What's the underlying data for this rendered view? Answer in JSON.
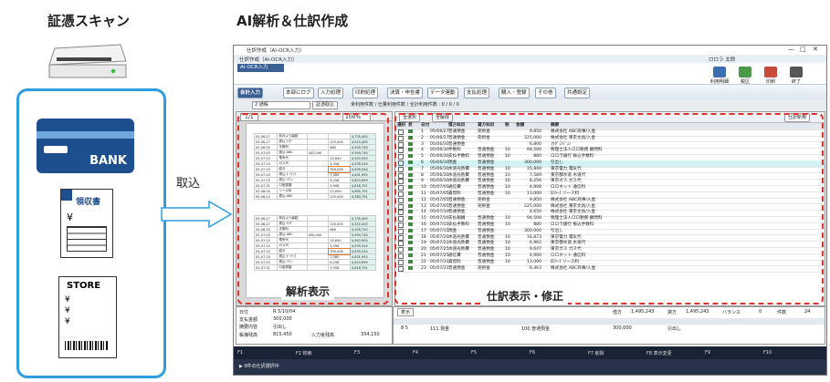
{
  "left_heading": "証憑スキャン",
  "right_heading": "AI解析＆仕訳作成",
  "arrow_label": "取込",
  "card_label": "BANK",
  "receipt_title": "領収書",
  "receipt_yen": "¥",
  "store_title": "STORE",
  "store_line": "¥",
  "window": {
    "title": "仕訳作成（AI-OCR入力）",
    "subtitle": "AI-OCR入力",
    "company": "ロロラ 太郎",
    "menu": [
      "会計入力",
      "本部にログ",
      "入力処理",
      "印刷処理",
      "決算・申告書",
      "データ連動",
      "支払処理",
      "購入・登録",
      "その他",
      "共通設定"
    ],
    "toolbar": {
      "dropdown": "2 通帳",
      "scan": "証憑取込",
      "filters": "未利用件数 / 仕量利用件数 / 全計利用件数 : 0 / 0 / 0"
    },
    "right_icons": [
      "利用明細",
      "税区",
      "印刷",
      "終了"
    ],
    "left_panel": {
      "page": "1/1",
      "zoom": "100%"
    },
    "doc_rows": [
      [
        "05-06-27",
        "前月より繰越",
        "",
        "",
        "4,735,400"
      ],
      [
        "05-06-27",
        "振込 ﾔﾏﾀﾞ",
        "",
        "225,000",
        "4,510,400"
      ],
      [
        "05-06-30",
        "手数料",
        "",
        "660",
        "4,509,740"
      ],
      [
        "05-07-05",
        "振込 ABC",
        "450,000",
        "",
        "4,959,740"
      ],
      [
        "05-07-10",
        "電気代",
        "",
        "15,840",
        "4,943,900"
      ],
      [
        "05-07-10",
        "ガス代",
        "",
        "4,356",
        "4,939,544"
      ],
      [
        "05-07-15",
        "給与",
        "",
        "300,000",
        "4,639,544"
      ],
      [
        "05-07-20",
        "振込 ｶﾞｲﾁｭｳ",
        "",
        "7,589",
        "4,631,955"
      ],
      [
        "05-07-25",
        "振込 ﾂｳｼﾝ",
        "",
        "8,256",
        "4,623,699"
      ],
      [
        "05-07-31",
        "口座振替",
        "",
        "4,908",
        "4,618,791"
      ],
      [
        "05-08-05",
        "リース料",
        "",
        "13,000",
        "4,605,791"
      ],
      [
        "05-08-10",
        "振込 ABC",
        "",
        "225,000",
        "4,380,791"
      ]
    ],
    "right_panel": {
      "btn_all_select": "全選択",
      "btn_all_release": "全解除",
      "btn_create": "仕訳新規",
      "cols": [
        "選択",
        "状",
        "日付",
        "借方科目",
        "貸方科目",
        "税",
        "金額",
        "摘要"
      ]
    },
    "journal": [
      [
        "1",
        "05/06/27",
        "普通預金",
        "売掛金",
        "",
        "9,850",
        "株式会社 ABC商事/入金"
      ],
      [
        "2",
        "05/06/27",
        "普通預金",
        "売掛金",
        "",
        "225,000",
        "株式会社 東京文具/入金"
      ],
      [
        "3",
        "05/06/30",
        "普通預金",
        "",
        "",
        "6,800",
        "カﾀﾞﾐ/ｼﾞｭﾝ"
      ],
      [
        "4",
        "05/06/30",
        "手数料",
        "普通預金",
        "10",
        "94,500",
        "税理士法人ロロ税務 顧問料"
      ],
      [
        "5",
        "05/06/30",
        "支払手数料",
        "普通預金",
        "10",
        "880",
        "ロロラ銀行 振込手数料"
      ],
      [
        "6",
        "05/06/30",
        "現金",
        "普通預金",
        "",
        "300,000",
        "引出し"
      ],
      [
        "7",
        "05/06/30",
        "水道光熱費",
        "普通預金",
        "10",
        "15,840",
        "東京電力 電気代"
      ],
      [
        "8",
        "05/06/30",
        "水道光熱費",
        "普通預金",
        "10",
        "7,589",
        "東京都水道 水道代"
      ],
      [
        "9",
        "05/06/30",
        "水道光熱費",
        "普通預金",
        "10",
        "8,256",
        "東京ガス ガス代"
      ],
      [
        "10",
        "05/07/05",
        "通信費",
        "普通預金",
        "10",
        "4,908",
        "ロロネット 通信料"
      ],
      [
        "11",
        "05/07/05",
        "賃借料",
        "普通預金",
        "10",
        "13,000",
        "ﾛﾛﾘｰｽ リース料"
      ],
      [
        "12",
        "05/07/05",
        "普通預金",
        "売掛金",
        "",
        "9,850",
        "株式会社 ABC商事/入金"
      ],
      [
        "13",
        "05/07/05",
        "普通預金",
        "売掛金",
        "",
        "225,000",
        "株式会社 東京文具/入金"
      ],
      [
        "14",
        "05/07/10",
        "普通預金",
        "",
        "",
        "4,650",
        "株式会社 東京文具/入金"
      ],
      [
        "15",
        "05/07/10",
        "支払報酬",
        "普通預金",
        "10",
        "94,500",
        "税理士法人ロロ税務 顧問料"
      ],
      [
        "16",
        "05/07/10",
        "支払手数料",
        "普通預金",
        "10",
        "880",
        "ロロラ銀行 振込手数料"
      ],
      [
        "17",
        "05/07/15",
        "現金",
        "普通預金",
        "",
        "300,000",
        "引出し"
      ],
      [
        "18",
        "05/07/20",
        "水道光熱費",
        "普通預金",
        "10",
        "16,873",
        "東京電力 電気代"
      ],
      [
        "19",
        "05/07/22",
        "水道光熱費",
        "普通預金",
        "10",
        "6,962",
        "東京都水道 水道代"
      ],
      [
        "20",
        "05/07/25",
        "水道光熱費",
        "普通預金",
        "10",
        "9,647",
        "東京ガス ガス代"
      ],
      [
        "21",
        "05/07/25",
        "通信費",
        "普通預金",
        "10",
        "4,900",
        "ロロネット 通信料"
      ],
      [
        "22",
        "05/07/31",
        "賃借料",
        "普通預金",
        "10",
        "13,000",
        "ﾛﾛﾘｰｽ リース料"
      ],
      [
        "23",
        "05/07/31",
        "普通預金",
        "売掛金",
        "",
        "6,463",
        "株式会社 ABC商事/入金"
      ]
    ],
    "bottom_left": {
      "date_label": "日付",
      "date": "R 5/10/04",
      "debit_label": "支払金額",
      "debit": "300,000",
      "memo_label": "摘要内容",
      "memo": "引出し",
      "balance_label": "帳簿残高",
      "balance": "815,450",
      "after_label": "入力後残高",
      "after": "334,150"
    },
    "bottom_right": {
      "show": "表示",
      "debit_total_label": "借方",
      "debit_total": "1,495,243",
      "credit_total_label": "貸方",
      "credit_total": "1,495,243",
      "balance_label": "バランス",
      "balance": "0",
      "count_label": "件数",
      "count": "24",
      "row": [
        "8 5",
        "111 現金",
        "",
        "100 普通預金",
        "",
        "300,000",
        "引出し"
      ]
    },
    "status": "▶ 9件の仕訳選択中",
    "fkeys": [
      "F1",
      "F2",
      "F3",
      "F4",
      "F5",
      "F6",
      "F7",
      "F8",
      "F9",
      "F10"
    ],
    "fkey_labels": [
      "",
      "検索",
      "",
      "",
      "",
      "",
      "削除",
      "表示変更",
      "",
      ""
    ]
  },
  "labels": {
    "analysis": "解析表示",
    "journal": "仕訳表示・修正"
  }
}
